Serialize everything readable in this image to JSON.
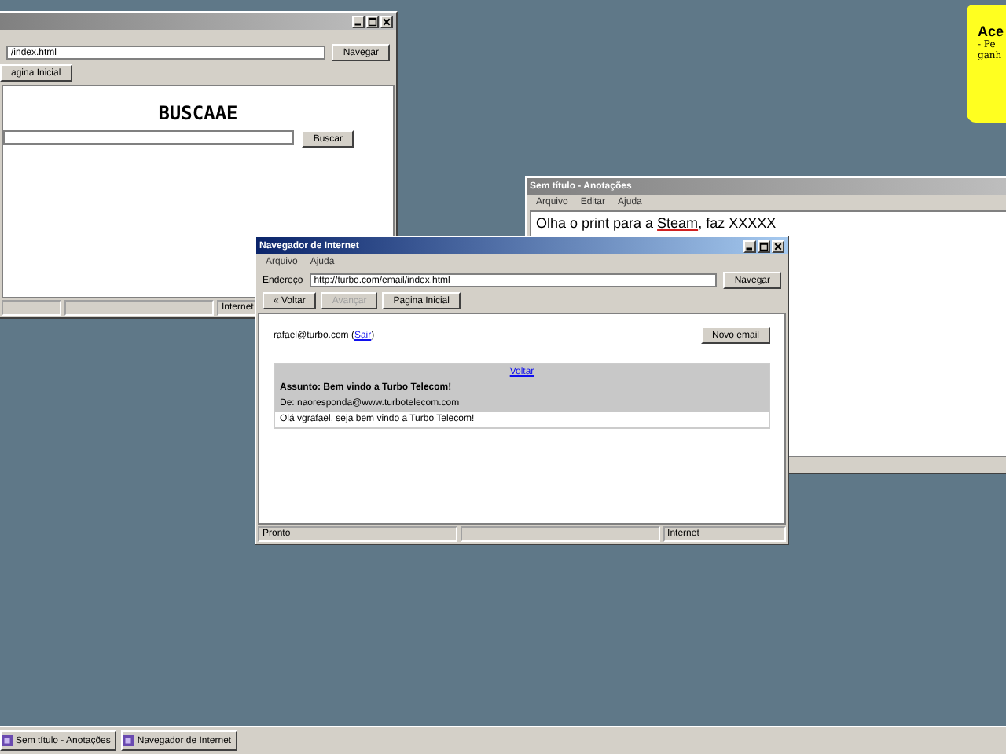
{
  "back_browser": {
    "active": false,
    "window_buttons_visible": true,
    "address": "/index.html",
    "buttons": [
      {
        "label": "Navegar"
      }
    ],
    "nav_buttons": [
      {
        "label": "agina Inicial",
        "disabled": false
      }
    ],
    "page": {
      "logo": "BUSCAAE",
      "search_button": "Buscar"
    },
    "status_bar": {
      "right": "Internet"
    }
  },
  "notepad": {
    "active": false,
    "window_buttons_visible": false,
    "title": "Sem título - Anotações",
    "menu": [
      "Arquivo",
      "Editar",
      "Ajuda"
    ],
    "text": {
      "before": "Olha o print para a ",
      "misspelled": "Steam",
      "after": ", faz XXXXX"
    }
  },
  "browser": {
    "active": true,
    "window_buttons_visible": true,
    "title": "Navegador de Internet",
    "menu": [
      "Arquivo",
      "Ajuda"
    ],
    "address_label": "Endereço",
    "address": "http://turbo.com/email/index.html",
    "go_button": "Navegar",
    "nav_buttons": [
      {
        "label": "« Voltar",
        "disabled": false
      },
      {
        "label": "Avançar",
        "disabled": true
      },
      {
        "label": "Pagina Inicial",
        "disabled": false
      }
    ],
    "user": {
      "before": "rafael@turbo.com (",
      "link": "Sair",
      "after": ")"
    },
    "new_email_button": "Novo email",
    "email": {
      "back_link": "Voltar",
      "subject": "Assunto: Bem vindo a Turbo Telecom!",
      "from": "De: naoresponda@www.turbotelecom.com",
      "body": "Olá vgrafael, seja bem vindo a Turbo Telecom!"
    },
    "status_bar": {
      "left": "Pronto",
      "right": "Internet"
    }
  },
  "sticky_note": {
    "title": "Ace",
    "lines": [
      "- Pe",
      "ganh"
    ]
  },
  "taskbar": {
    "items": [
      {
        "label": "Sem título - Anotações",
        "selected": false
      },
      {
        "label": "Navegador de Internet",
        "selected": false
      }
    ]
  }
}
